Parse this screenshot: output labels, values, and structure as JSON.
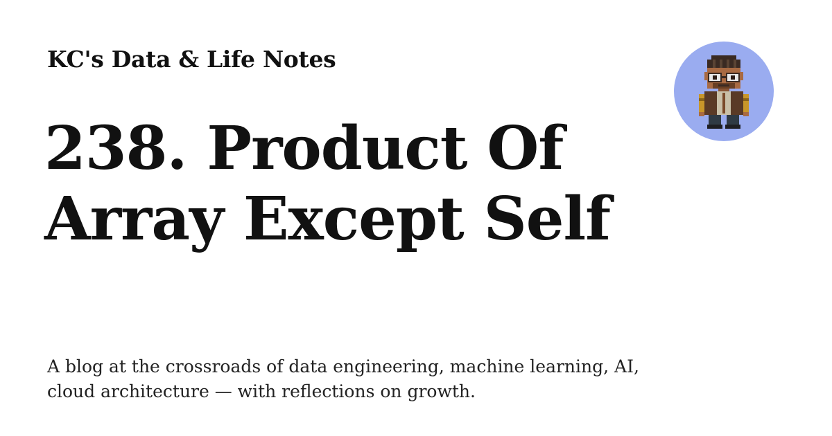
{
  "site": {
    "name": "KC's Data & Life Notes"
  },
  "post": {
    "title": "238. Product Of Array Except Self"
  },
  "tagline": "A blog at the crossroads of data engineering, machine learning, AI, cloud architecture — with reflections on growth.",
  "avatar": {
    "icon": "pixel-art-person-icon",
    "background_color": "#9aacf0"
  },
  "colors": {
    "background": "#ffffff",
    "text": "#111111"
  }
}
